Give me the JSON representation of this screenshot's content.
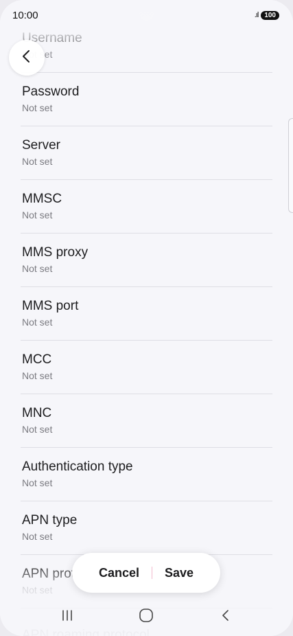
{
  "status_bar": {
    "time": "10:00",
    "signal": ".ıl",
    "battery": "100"
  },
  "fields": [
    {
      "title": "Username",
      "value": "Not set"
    },
    {
      "title": "Password",
      "value": "Not set"
    },
    {
      "title": "Server",
      "value": "Not set"
    },
    {
      "title": "MMSC",
      "value": "Not set"
    },
    {
      "title": "MMS proxy",
      "value": "Not set"
    },
    {
      "title": "MMS port",
      "value": "Not set"
    },
    {
      "title": "MCC",
      "value": "Not set"
    },
    {
      "title": "MNC",
      "value": "Not set"
    },
    {
      "title": "Authentication type",
      "value": "Not set"
    },
    {
      "title": "APN type",
      "value": "Not set"
    },
    {
      "title": "APN protocol",
      "value": "Not set"
    },
    {
      "title": "APN roaming protocol",
      "value": ""
    }
  ],
  "actions": {
    "cancel_label": "Cancel",
    "save_label": "Save"
  },
  "icons": {
    "back": "chevron-left-icon",
    "recents": "recents-icon",
    "home": "home-icon",
    "nav_back": "nav-back-icon"
  },
  "colors": {
    "divider_accent": "#f2b8cc",
    "background": "#f6f6fa"
  }
}
